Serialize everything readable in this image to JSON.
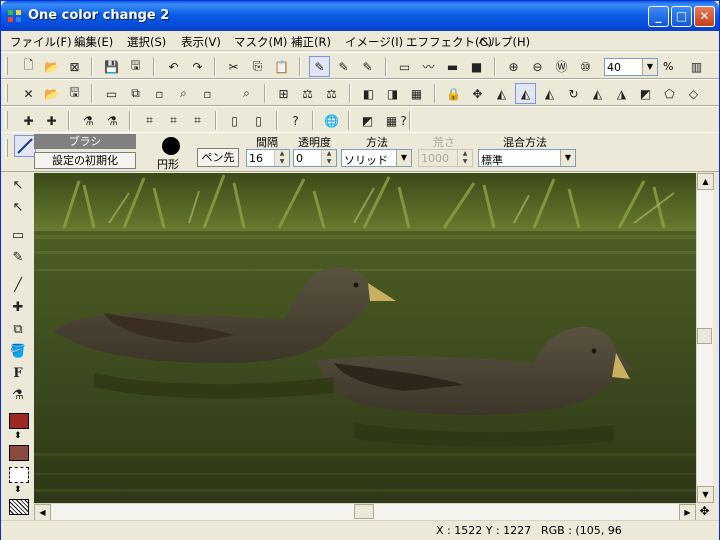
{
  "window": {
    "title": "One color change 2"
  },
  "menu": [
    {
      "label": "ファイル(F)"
    },
    {
      "label": "編集(E)"
    },
    {
      "label": "選択(S)"
    },
    {
      "label": "表示(V)"
    },
    {
      "label": "マスク(M)"
    },
    {
      "label": "補正(R)"
    },
    {
      "label": "イメージ(I)"
    },
    {
      "label": "エフフェクト(C)"
    },
    {
      "label": "ヘルプ(H)"
    }
  ],
  "toolbar": {
    "zoom_value": "40",
    "zoom_unit": "%"
  },
  "brush_options": {
    "brush_name": "ブラシ",
    "reset_label": "設定の初期化",
    "shape_label": "円形",
    "pen_tip_label": "ペン先",
    "interval_label": "間隔",
    "interval_value": "16",
    "opacity_label": "透明度",
    "opacity_value": "0",
    "method_label": "方法",
    "method_value": "ソリッド",
    "sharpness_label": "荒さ",
    "sharpness_value": "1000",
    "blend_label": "混合方法",
    "blend_value": "標準"
  },
  "colors": {
    "foreground": "#9b2a22",
    "background": "#8a4a40",
    "accent": "#0a5de8"
  },
  "status": {
    "coords": "X : 1522   Y : 1227",
    "rgb": "RGB : (105, 96"
  }
}
